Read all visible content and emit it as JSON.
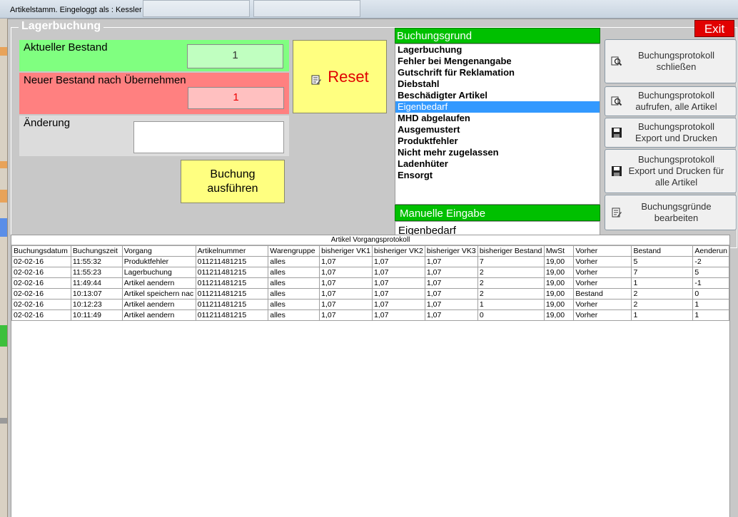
{
  "window": {
    "title": "Artikelstamm. Eingeloggt als : Kessler"
  },
  "group": {
    "title": "Lagerbuchung"
  },
  "exit": {
    "label": "Exit"
  },
  "stock": {
    "current_label": "Aktueller Bestand",
    "current_value": "1",
    "new_label": "Neuer Bestand nach Übernehmen",
    "new_value": "1",
    "change_label": "Änderung",
    "change_value": ""
  },
  "buttons": {
    "reset": "Reset",
    "execute_line1": "Buchung",
    "execute_line2": "ausführen"
  },
  "reasons": {
    "header": "Buchungsgrund",
    "items": [
      "Lagerbuchung",
      "Fehler bei Mengenangabe",
      "Gutschrift für Reklamation",
      "Diebstahl",
      "Beschädigter Artikel",
      "Eigenbedarf",
      "MHD abgelaufen",
      "Ausgemustert",
      "Produktfehler",
      "Nicht mehr zugelassen",
      "Ladenhüter",
      "Ensorgt"
    ],
    "selected_index": 5
  },
  "manual": {
    "header": "Manuelle Eingabe",
    "value": "Eigenbedarf"
  },
  "side_buttons": [
    {
      "line1": "Buchungsprotokoll",
      "line2": "schließen",
      "line3": "",
      "icon": "magnifier-doc-icon"
    },
    {
      "line1": "Buchungsprotokoll",
      "line2": "aufrufen, alle Artikel",
      "line3": "",
      "icon": "magnifier-doc-icon"
    },
    {
      "line1": "Buchungsprotokoll",
      "line2": "Export und Drucken",
      "line3": "",
      "icon": "floppy-disk-icon"
    },
    {
      "line1": "Buchungsprotokoll",
      "line2": "Export und Drucken für",
      "line3": "alle Artikel",
      "icon": "floppy-disk-icon"
    },
    {
      "line1": "Buchungsgründe",
      "line2": "bearbeiten",
      "line3": "",
      "icon": "edit-doc-icon"
    }
  ],
  "protocol": {
    "title": "Artikel Vorgangsprotokoll",
    "columns": [
      "Buchungsdatum",
      "Buchungszeit",
      "Vorgang",
      "Artikelnummer",
      "Warengruppe",
      "bisheriger VK1",
      "bisheriger VK2",
      "bisheriger VK3",
      "bisheriger Bestand",
      "MwSt",
      "Vorher",
      "Bestand",
      "Aenderun"
    ],
    "rows": [
      [
        "02-02-16",
        "11:55:32",
        "Produktfehler",
        "011211481215",
        "alles",
        "1,07",
        "1,07",
        "1,07",
        "7",
        "19,00",
        "Vorher",
        "5",
        "-2"
      ],
      [
        "02-02-16",
        "11:55:23",
        "Lagerbuchung",
        "011211481215",
        "alles",
        "1,07",
        "1,07",
        "1,07",
        "2",
        "19,00",
        "Vorher",
        "7",
        "5"
      ],
      [
        "02-02-16",
        "11:49:44",
        "Artikel aendern",
        "011211481215",
        "alles",
        "1,07",
        "1,07",
        "1,07",
        "2",
        "19,00",
        "Vorher",
        "1",
        "-1"
      ],
      [
        "02-02-16",
        "10:13:07",
        "Artikel speichern nac",
        "011211481215",
        "alles",
        "1,07",
        "1,07",
        "1,07",
        "2",
        "19,00",
        "Bestand",
        "2",
        "0"
      ],
      [
        "02-02-16",
        "10:12:23",
        "Artikel aendern",
        "011211481215",
        "alles",
        "1,07",
        "1,07",
        "1,07",
        "1",
        "19,00",
        "Vorher",
        "2",
        "1"
      ],
      [
        "02-02-16",
        "10:11:49",
        "Artikel aendern",
        "011211481215",
        "alles",
        "1,07",
        "1,07",
        "1,07",
        "0",
        "19,00",
        "Vorher",
        "1",
        "1"
      ]
    ]
  },
  "colors": {
    "green_panel": "#80ff80",
    "red_panel": "#ff8080",
    "yellow_button": "#ffff80",
    "list_header_green": "#00c000",
    "selection_blue": "#3399ff",
    "exit_red": "#e10000"
  }
}
